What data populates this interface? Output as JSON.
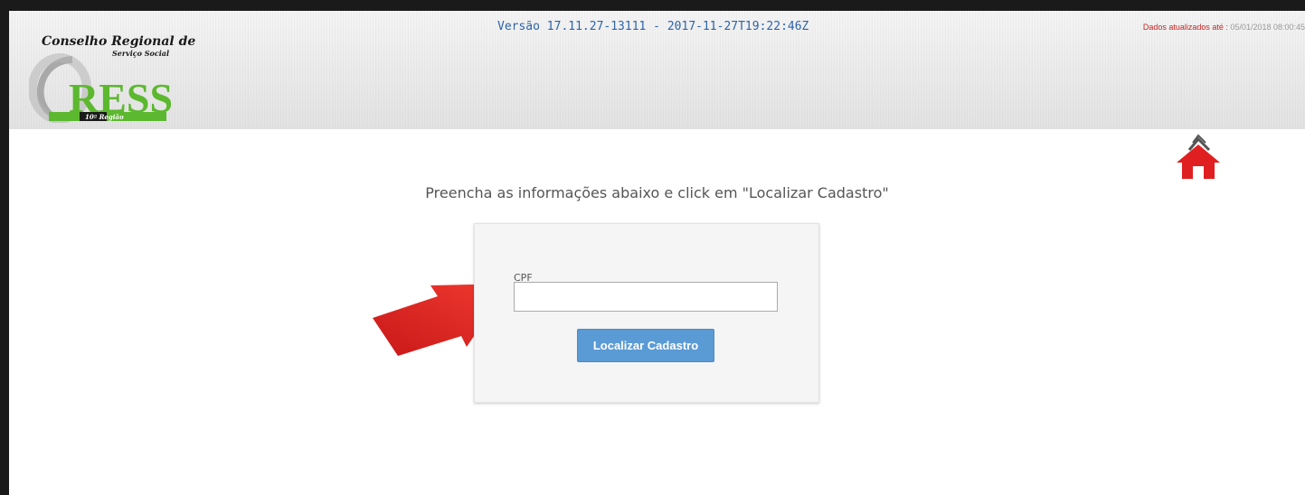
{
  "header": {
    "logo": {
      "title": "Conselho Regional de",
      "subtitle": "Serviço Social",
      "wordmark": "RESS",
      "region": "10ª Região"
    },
    "version": "Versão 17.11.27-13111 - 2017-11-27T19:22:46Z",
    "updated_label": "Dados atualizados até :",
    "updated_value": "05/01/2018 08:00:45"
  },
  "home": {
    "icon": "home-icon",
    "color": "#e02020"
  },
  "main": {
    "instructions": "Preencha as informações abaixo e click em \"Localizar Cadastro\"",
    "form": {
      "cpf_label": "CPF",
      "cpf_value": "",
      "submit_label": "Localizar Cadastro"
    }
  },
  "annotation": {
    "icon": "red-arrow-icon",
    "color": "#e3201b"
  },
  "colors": {
    "accent": "#5b9bd5",
    "logo_green": "#5cb82e",
    "version_text": "#2c64a8",
    "alert_text": "#cc2222"
  }
}
